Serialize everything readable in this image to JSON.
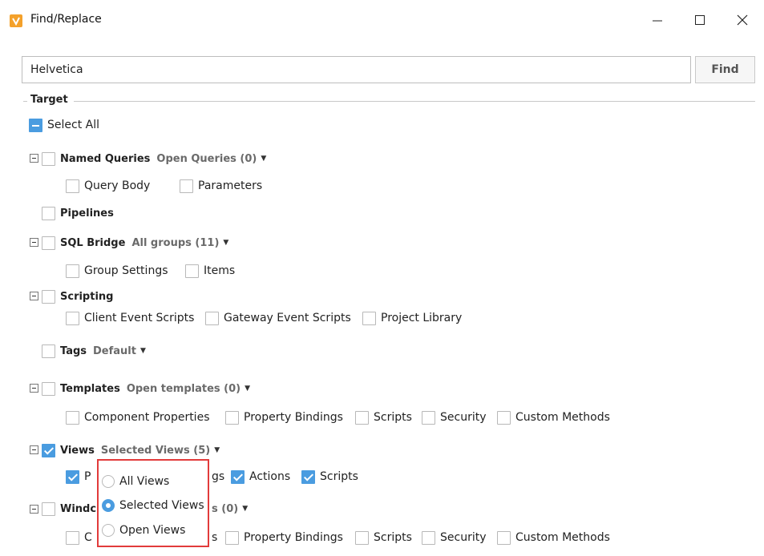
{
  "window": {
    "title": "Find/Replace",
    "icon": "ignition-icon",
    "controls": [
      "minimize-icon",
      "maximize-icon",
      "close-icon"
    ]
  },
  "search": {
    "value": "Helvetica",
    "find_label": "Find"
  },
  "target": {
    "label": "Target",
    "select_all": "Select All",
    "named_queries": {
      "label": "Named Queries",
      "dropdown": "Open Queries (0)",
      "subs": [
        "Query Body",
        "Parameters"
      ]
    },
    "pipelines": {
      "label": "Pipelines"
    },
    "sql_bridge": {
      "label": "SQL Bridge",
      "dropdown": "All groups (11)",
      "subs": [
        "Group Settings",
        "Items"
      ]
    },
    "scripting": {
      "label": "Scripting",
      "subs": [
        "Client Event Scripts",
        "Gateway Event Scripts",
        "Project Library"
      ]
    },
    "tags": {
      "label": "Tags",
      "dropdown": "Default"
    },
    "templates": {
      "label": "Templates",
      "dropdown": "Open templates (0)",
      "subs": [
        "Component Properties",
        "Property Bindings",
        "Scripts",
        "Security",
        "Custom Methods"
      ]
    },
    "views": {
      "label": "Views",
      "dropdown": "Selected Views (5)",
      "subs": [
        "P",
        "gs",
        "Actions",
        "Scripts"
      ]
    },
    "windows": {
      "label": "Windc",
      "dropdown_tail": "s (0)",
      "subs": [
        "C",
        "s",
        "Property Bindings",
        "Scripts",
        "Security",
        "Custom Methods"
      ]
    }
  },
  "views_popup": {
    "options": [
      "All Views",
      "Selected Views",
      "Open Views"
    ],
    "selected": "Selected Views"
  },
  "colors": {
    "accent": "#4a9ce0",
    "highlight": "#e23b3b",
    "app_icon": "#f4a12b"
  }
}
